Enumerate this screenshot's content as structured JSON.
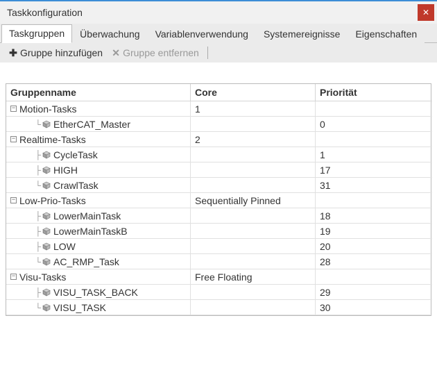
{
  "window": {
    "title": "Taskkonfiguration"
  },
  "tabs": {
    "items": [
      "Taskgruppen",
      "Überwachung",
      "Variablenverwendung",
      "Systemereignisse",
      "Eigenschaften"
    ],
    "active_index": 0
  },
  "toolbar": {
    "add_label": "Gruppe hinzufügen",
    "remove_label": "Gruppe entfernen"
  },
  "table": {
    "headers": {
      "name": "Gruppenname",
      "core": "Core",
      "priority": "Priorität"
    },
    "groups": [
      {
        "name": "Motion-Tasks",
        "core": "1",
        "tasks": [
          {
            "name": "EtherCAT_Master",
            "priority": "0"
          }
        ]
      },
      {
        "name": "Realtime-Tasks",
        "core": "2",
        "tasks": [
          {
            "name": "CycleTask",
            "priority": "1"
          },
          {
            "name": "HIGH",
            "priority": "17"
          },
          {
            "name": "CrawlTask",
            "priority": "31"
          }
        ]
      },
      {
        "name": "Low-Prio-Tasks",
        "core": "Sequentially Pinned",
        "tasks": [
          {
            "name": "LowerMainTask",
            "priority": "18"
          },
          {
            "name": "LowerMainTaskB",
            "priority": "19"
          },
          {
            "name": "LOW",
            "priority": "20"
          },
          {
            "name": "AC_RMP_Task",
            "priority": "28"
          }
        ]
      },
      {
        "name": "Visu-Tasks",
        "core": "Free Floating",
        "tasks": [
          {
            "name": "VISU_TASK_BACK",
            "priority": "29"
          },
          {
            "name": "VISU_TASK",
            "priority": "30"
          }
        ]
      }
    ]
  }
}
